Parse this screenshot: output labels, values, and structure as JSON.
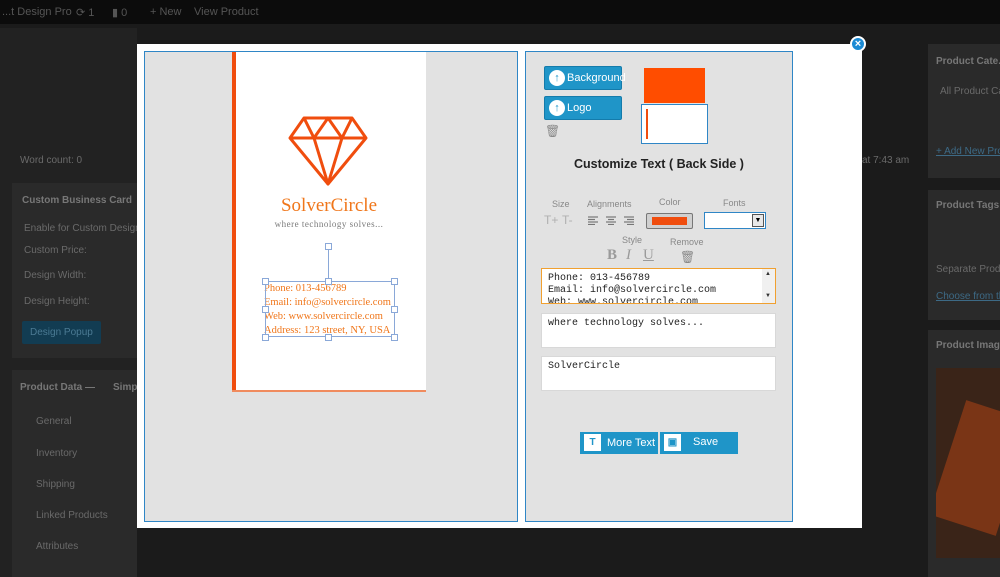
{
  "admin_bar": {
    "site_name": "...t Design Pro",
    "updates_count": "1",
    "comments_count": "0",
    "new_label": "New",
    "view_product": "View Product"
  },
  "background": {
    "word_count": "Word count: 0",
    "last_edited": "at 7:43 am",
    "metabox_title": "Custom Business Card",
    "enable_label": "Enable for Custom Design",
    "custom_price": "Custom Price:",
    "design_width": "Design Width:",
    "design_height": "Design Height:",
    "design_popup_button": "Design Popup",
    "product_data": "Product Data —",
    "product_type": "Simp",
    "tabs": [
      "General",
      "Inventory",
      "Shipping",
      "Linked Products",
      "Attributes"
    ],
    "product_categories": "Product Cate...",
    "all_product_categories": "All Product Ca...",
    "add_new": "+ Add New Pro...",
    "product_tags": "Product Tags",
    "separate_product": "Separate Produc...",
    "choose_from": "Choose from th...",
    "product_image": "Product Imag..."
  },
  "card": {
    "company_name": "SolverCircle",
    "tagline": "where technology solves...",
    "contact_lines": [
      "Phone: 013-456789",
      "Email: info@solvercircle.com",
      "Web: www.solvercircle.com",
      "Address: 123 street, NY, USA"
    ],
    "accent_color": "#f04d0e",
    "logo_icon": "diamond-icon"
  },
  "editor": {
    "background_button": "Background",
    "logo_button": "Logo",
    "title": "Customize Text ( Back Side )",
    "size_label": "Size",
    "size_increase": "T+",
    "size_decrease": "T-",
    "alignments_label": "Alignments",
    "color_label": "Color",
    "fonts_label": "Fonts",
    "style_label": "Style",
    "remove_label": "Remove",
    "bold": "B",
    "italic": "I",
    "underline": "U",
    "selected_color": "#f04d0e",
    "background_color": "#ff4d00",
    "text_fields": [
      "Phone: 013-456789\nEmail: info@solvercircle.com\nWeb: www.solvercircle.com",
      "where technology solves...",
      "SolverCircle"
    ],
    "more_text_button": "More Text",
    "save_button": "Save"
  }
}
